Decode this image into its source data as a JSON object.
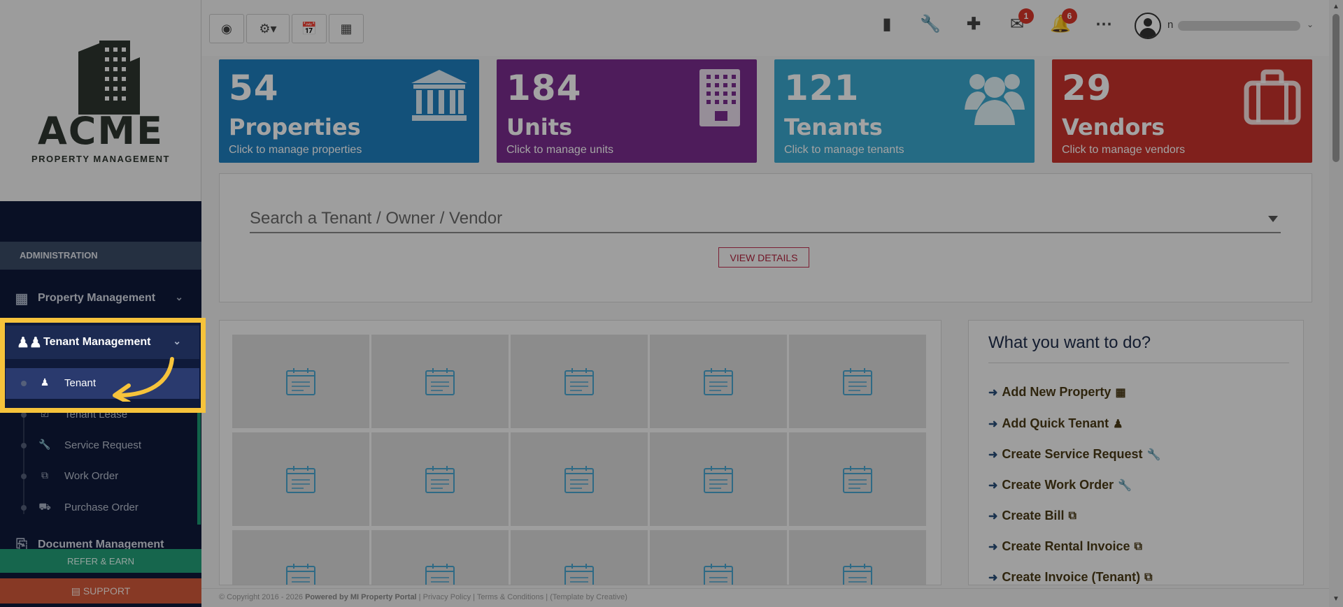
{
  "logo": {
    "name": "ACME",
    "subtitle": "PROPERTY MANAGEMENT"
  },
  "sidebar": {
    "section_header": "ADMINISTRATION",
    "items": [
      {
        "label": "Property Management",
        "icon": "building-icon"
      },
      {
        "label": "Tenant Management",
        "icon": "users-icon",
        "active": true
      }
    ],
    "sub_items": [
      {
        "label": "Tenant",
        "icon": "user-icon",
        "active": true
      },
      {
        "label": "Tenant Lease",
        "icon": "check-square-icon"
      },
      {
        "label": "Service Request",
        "icon": "wrench-icon"
      },
      {
        "label": "Work Order",
        "icon": "copy-icon"
      },
      {
        "label": "Purchase Order",
        "icon": "truck-icon"
      }
    ],
    "next_item": {
      "label": "Document Management",
      "icon": "document-icon"
    },
    "refer_label": "REFER & EARN",
    "support_label": "SUPPORT"
  },
  "topbar": {
    "buttons": [
      "dashboard-icon",
      "gear-icon",
      "calendar-check-icon",
      "calculator-icon"
    ],
    "icons": [
      "bar-chart-icon",
      "wrench-icon",
      "plus-icon",
      "mail-icon",
      "bell-icon",
      "ellipsis-icon"
    ],
    "mail_badge": "1",
    "bell_badge": "6",
    "user_initial": "n"
  },
  "stats": [
    {
      "number": "54",
      "title": "Properties",
      "subtitle": "Click to manage properties",
      "color": "#1f7fbf",
      "icon": "bank-icon"
    },
    {
      "number": "184",
      "title": "Units",
      "subtitle": "Click to manage units",
      "color": "#7a2d8f",
      "icon": "building-icon"
    },
    {
      "number": "121",
      "title": "Tenants",
      "subtitle": "Click to manage tenants",
      "color": "#3aa8cf",
      "icon": "users-icon"
    },
    {
      "number": "29",
      "title": "Vendors",
      "subtitle": "Click to manage vendors",
      "color": "#c8332c",
      "icon": "briefcase-icon"
    }
  ],
  "search": {
    "placeholder": "Search a Tenant / Owner / Vendor",
    "view_details": "VIEW DETAILS"
  },
  "want": {
    "title": "What you want to do?",
    "items": [
      {
        "label": "Add New Property",
        "icon": "building-icon"
      },
      {
        "label": "Add Quick Tenant",
        "icon": "user-icon"
      },
      {
        "label": "Create Service Request",
        "icon": "wrench-icon"
      },
      {
        "label": "Create Work Order",
        "icon": "wrench-icon"
      },
      {
        "label": "Create Bill",
        "icon": "copy-icon"
      },
      {
        "label": "Create Rental Invoice",
        "icon": "copy-icon"
      },
      {
        "label": "Create Invoice (Tenant)",
        "icon": "copy-icon"
      }
    ]
  },
  "footer": {
    "copyright": "© Copyright 2016 - 2026",
    "powered": "Powered by MI Property Portal",
    "privacy": "Privacy Policy",
    "terms": "Terms & Conditions",
    "template": "(Template by Creative)"
  },
  "colors": {
    "sidebar_bg": "#0f1a3a",
    "highlight": "#f6c33b",
    "refer": "#23a079",
    "support": "#d35a3b"
  }
}
